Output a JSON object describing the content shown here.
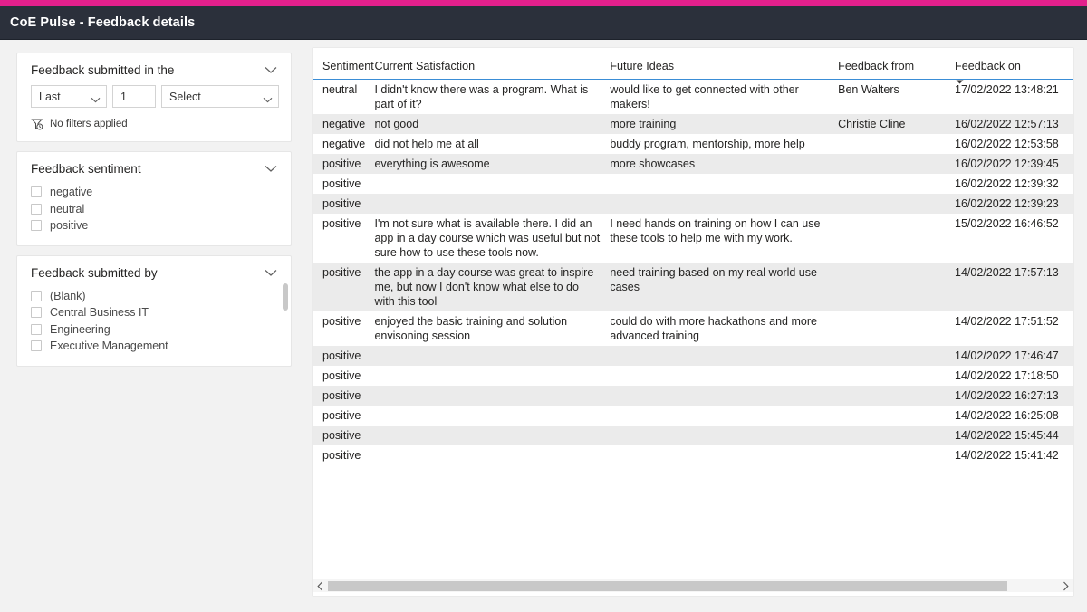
{
  "app": {
    "title": "CoE Pulse - Feedback details",
    "accent_color": "#e4208c",
    "header_bg": "#2b303b"
  },
  "filters": {
    "date_card": {
      "title": "Feedback submitted in the",
      "collapse_icon": "chevron-down-icon",
      "relative_mode": "Last",
      "relative_count": "1",
      "relative_unit": "Select",
      "status_icon": "filter-clock-icon",
      "status_text": "No filters applied"
    },
    "sentiment_card": {
      "title": "Feedback sentiment",
      "collapse_icon": "chevron-down-icon",
      "items": [
        {
          "label": "negative",
          "checked": false
        },
        {
          "label": "neutral",
          "checked": false
        },
        {
          "label": "positive",
          "checked": false
        }
      ]
    },
    "submitted_by_card": {
      "title": "Feedback submitted by",
      "collapse_icon": "chevron-down-icon",
      "items": [
        {
          "label": "(Blank)",
          "checked": false
        },
        {
          "label": "Central Business IT",
          "checked": false
        },
        {
          "label": "Engineering",
          "checked": false
        },
        {
          "label": "Executive Management",
          "checked": false
        }
      ],
      "has_scrollbar": true
    }
  },
  "table": {
    "columns": [
      {
        "key": "sentiment",
        "label": "Sentiment",
        "sorted": false
      },
      {
        "key": "current",
        "label": "Current Satisfaction",
        "sorted": false
      },
      {
        "key": "future",
        "label": "Future Ideas",
        "sorted": false
      },
      {
        "key": "from",
        "label": "Feedback from",
        "sorted": false
      },
      {
        "key": "on",
        "label": "Feedback on",
        "sorted": true,
        "sort_direction": "desc",
        "sort_icon": "caret-down-icon"
      }
    ],
    "header_underline_color": "#3a8dd6",
    "alt_row_color": "#ebebeb",
    "rows": [
      {
        "sentiment": "neutral",
        "current": "I didn't know there was a program. What is part of it?",
        "future": "would like to get connected with other makers!",
        "from": "Ben Walters",
        "on": "17/02/2022 13:48:21"
      },
      {
        "sentiment": "negative",
        "current": "not good",
        "future": "more training",
        "from": "Christie Cline",
        "on": "16/02/2022 12:57:13"
      },
      {
        "sentiment": "negative",
        "current": "did not help me at all",
        "future": "buddy program, mentorship, more help",
        "from": "",
        "on": "16/02/2022 12:53:58"
      },
      {
        "sentiment": "positive",
        "current": "everything is awesome",
        "future": "more showcases",
        "from": "",
        "on": "16/02/2022 12:39:45"
      },
      {
        "sentiment": "positive",
        "current": "",
        "future": "",
        "from": "",
        "on": "16/02/2022 12:39:32"
      },
      {
        "sentiment": "positive",
        "current": "",
        "future": "",
        "from": "",
        "on": "16/02/2022 12:39:23"
      },
      {
        "sentiment": "positive",
        "current": "I'm not sure what is available there. I did an app in a day course which was useful but not sure how to use these tools now.",
        "future": "I need hands on training on how I can use these tools to help me with my work.",
        "from": "",
        "on": "15/02/2022 16:46:52"
      },
      {
        "sentiment": "positive",
        "current": "the app in a day course was great to inspire me, but now I don't know what else to do with this tool",
        "future": "need training based on my real world use cases",
        "from": "",
        "on": "14/02/2022 17:57:13"
      },
      {
        "sentiment": "positive",
        "current": "enjoyed the basic training and solution envisoning session",
        "future": "could do with more hackathons and more advanced training",
        "from": "",
        "on": "14/02/2022 17:51:52"
      },
      {
        "sentiment": "positive",
        "current": "",
        "future": "",
        "from": "",
        "on": "14/02/2022 17:46:47"
      },
      {
        "sentiment": "positive",
        "current": "",
        "future": "",
        "from": "",
        "on": "14/02/2022 17:18:50"
      },
      {
        "sentiment": "positive",
        "current": "",
        "future": "",
        "from": "",
        "on": "14/02/2022 16:27:13"
      },
      {
        "sentiment": "positive",
        "current": "",
        "future": "",
        "from": "",
        "on": "14/02/2022 16:25:08"
      },
      {
        "sentiment": "positive",
        "current": "",
        "future": "",
        "from": "",
        "on": "14/02/2022 15:45:44"
      },
      {
        "sentiment": "positive",
        "current": "",
        "future": "",
        "from": "",
        "on": "14/02/2022 15:41:42"
      }
    ],
    "h_scroll": {
      "left_arrow_icon": "chevron-left-icon",
      "right_arrow_icon": "chevron-right-icon",
      "thumb_percent": 93
    }
  }
}
